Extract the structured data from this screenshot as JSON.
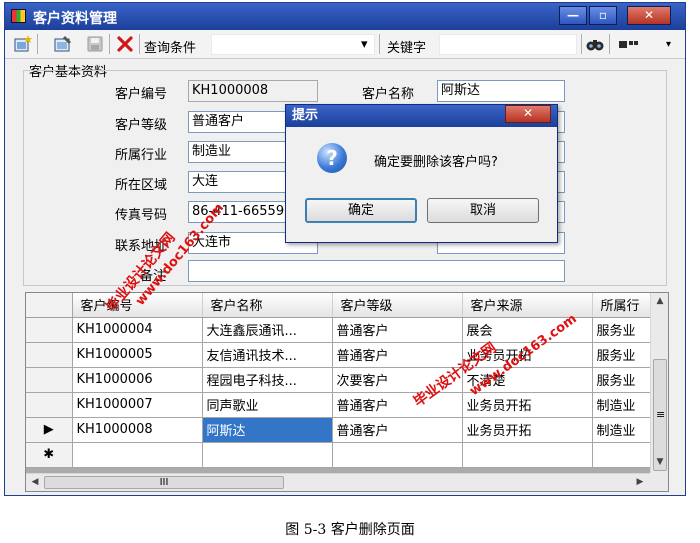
{
  "window": {
    "title": "客户资料管理",
    "minimize": "—",
    "maximize": "▫",
    "close": "✕"
  },
  "toolbar": {
    "query_label": "查询条件",
    "dropdown_arrow": "▾",
    "keyword_label": "关键字",
    "binoculars": "🔍",
    "more_label": "▭▫",
    "overflow": "▾"
  },
  "form": {
    "group_title": "客户基本资料",
    "fields": {
      "customer_id": {
        "label": "客户编号",
        "value": "KH1000008"
      },
      "customer_name": {
        "label": "客户名称",
        "value": "阿斯达"
      },
      "customer_level": {
        "label": "客户等级",
        "value": "普通客户"
      },
      "industry": {
        "label": "所属行业",
        "value": "制造业"
      },
      "region": {
        "label": "所在区域",
        "value": "大连"
      },
      "fax": {
        "label": "传真号码",
        "value": "86-411-66559"
      },
      "address": {
        "label": "联系地址",
        "value": "大连市"
      },
      "remark": {
        "label": "备注",
        "value": ""
      }
    }
  },
  "grid": {
    "columns": [
      "客户编号",
      "客户名称",
      "客户等级",
      "客户来源",
      "所属行"
    ],
    "rows": [
      {
        "marker": "",
        "id": "KH1000004",
        "name": "大连鑫辰通讯...",
        "level": "普通客户",
        "source": "展会",
        "industry": "服务业"
      },
      {
        "marker": "",
        "id": "KH1000005",
        "name": "友信通讯技术...",
        "level": "普通客户",
        "source": "业务员开拓",
        "industry": "服务业"
      },
      {
        "marker": "",
        "id": "KH1000006",
        "name": "程园电子科技...",
        "level": "次要客户",
        "source": "不清楚",
        "industry": "服务业"
      },
      {
        "marker": "",
        "id": "KH1000007",
        "name": "同声歌业",
        "level": "普通客户",
        "source": "业务员开拓",
        "industry": "制造业"
      },
      {
        "marker": "▶",
        "id": "KH1000008",
        "name": "阿斯达",
        "level": "普通客户",
        "source": "业务员开拓",
        "industry": "制造业"
      }
    ],
    "new_row_marker": "✱",
    "hscroll_grip": "III",
    "vscroll_grip": "≡",
    "arrows": {
      "up": "▲",
      "down": "▼",
      "left": "◀",
      "right": "▶"
    }
  },
  "dialog": {
    "title": "提示",
    "close": "✕",
    "message": "确定要删除该客户吗?",
    "icon": "?",
    "ok": "确定",
    "cancel": "取消"
  },
  "watermark": {
    "line1": "毕业设计论文网",
    "line2": "www.doc163.com"
  },
  "caption": "图 5-3 客户删除页面"
}
